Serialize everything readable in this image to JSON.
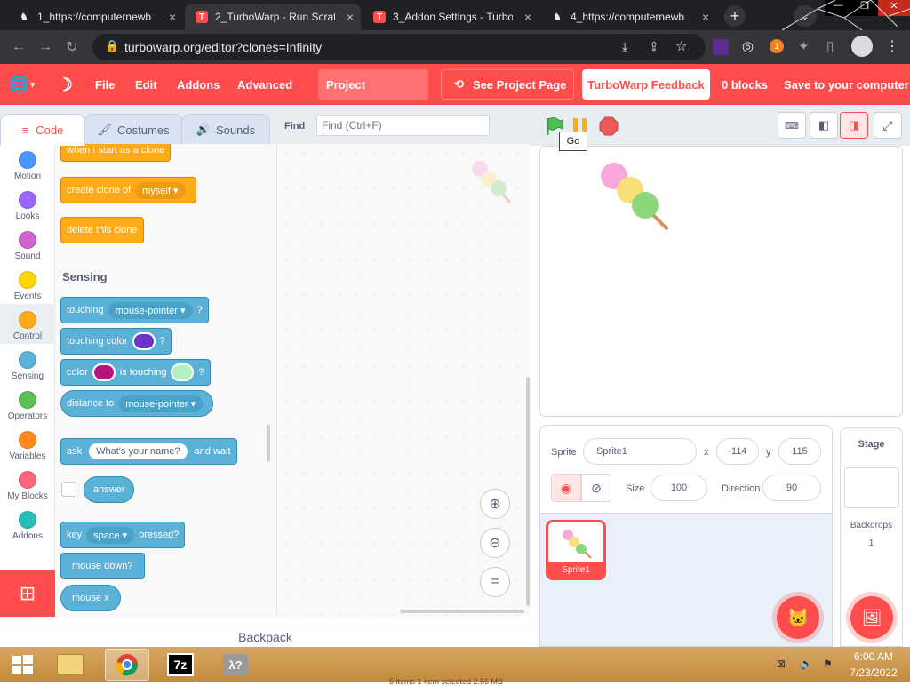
{
  "browser": {
    "tabs": [
      {
        "label": "1_https://computernewb",
        "active": false
      },
      {
        "label": "2_TurboWarp - Run Scrat",
        "active": true
      },
      {
        "label": "3_Addon Settings - Turbo",
        "active": false
      },
      {
        "label": "4_https://computernewb",
        "active": false
      }
    ],
    "url": "turbowarp.org/editor?clones=Infinity",
    "extension_badge": "1"
  },
  "menubar": {
    "file": "File",
    "edit": "Edit",
    "addons": "Addons",
    "advanced": "Advanced",
    "project_title": "Project",
    "see_project_page": "See Project Page",
    "feedback": "TurboWarp Feedback",
    "blocks_count": "0 blocks",
    "save": "Save to your computer"
  },
  "editor_tabs": {
    "code": "Code",
    "costumes": "Costumes",
    "sounds": "Sounds"
  },
  "find": {
    "label": "Find",
    "placeholder": "Find (Ctrl+F)"
  },
  "categories": [
    {
      "label": "Motion",
      "color": "#4c97ff"
    },
    {
      "label": "Looks",
      "color": "#9966ff"
    },
    {
      "label": "Sound",
      "color": "#cf63cf"
    },
    {
      "label": "Events",
      "color": "#ffd500"
    },
    {
      "label": "Control",
      "color": "#ffab19"
    },
    {
      "label": "Sensing",
      "color": "#5cb1d6"
    },
    {
      "label": "Operators",
      "color": "#59c059"
    },
    {
      "label": "Variables",
      "color": "#ff8c1a"
    },
    {
      "label": "My Blocks",
      "color": "#ff6680"
    },
    {
      "label": "Addons",
      "color": "#29beb8"
    }
  ],
  "blocks": {
    "when_clone": "when I start as a clone",
    "create_clone": "create clone of",
    "create_clone_arg": "myself",
    "delete_clone": "delete this clone",
    "sensing_header": "Sensing",
    "touching": "touching",
    "touching_arg": "mouse-pointer",
    "q": "?",
    "touching_color": "touching color",
    "color": "color",
    "is_touching": "is touching",
    "distance_to": "distance to",
    "distance_arg": "mouse-pointer",
    "ask": "ask",
    "ask_arg": "What's your name?",
    "and_wait": "and wait",
    "answer": "answer",
    "key": "key",
    "key_arg": "space",
    "pressed": "pressed?",
    "mouse_down": "mouse down?",
    "mouse_x": "mouse x",
    "color_purple": "#6b33c9",
    "color_magenta": "#b5157e",
    "color_mint": "#b3f2c0"
  },
  "backpack": "Backpack",
  "stage": {
    "go_tooltip": "Go"
  },
  "sprite": {
    "label": "Sprite",
    "name": "Sprite1",
    "x_label": "x",
    "x": "-114",
    "y_label": "y",
    "y": "115",
    "size_label": "Size",
    "size": "100",
    "direction_label": "Direction",
    "direction": "90",
    "thumb_label": "Sprite1"
  },
  "stage_panel": {
    "title": "Stage",
    "backdrops_label": "Backdrops",
    "backdrops_count": "1"
  },
  "taskbar": {
    "time": "6:00 AM",
    "date": "7/23/2022",
    "status_text": "5 items  1 item selected  2.56 MB"
  }
}
